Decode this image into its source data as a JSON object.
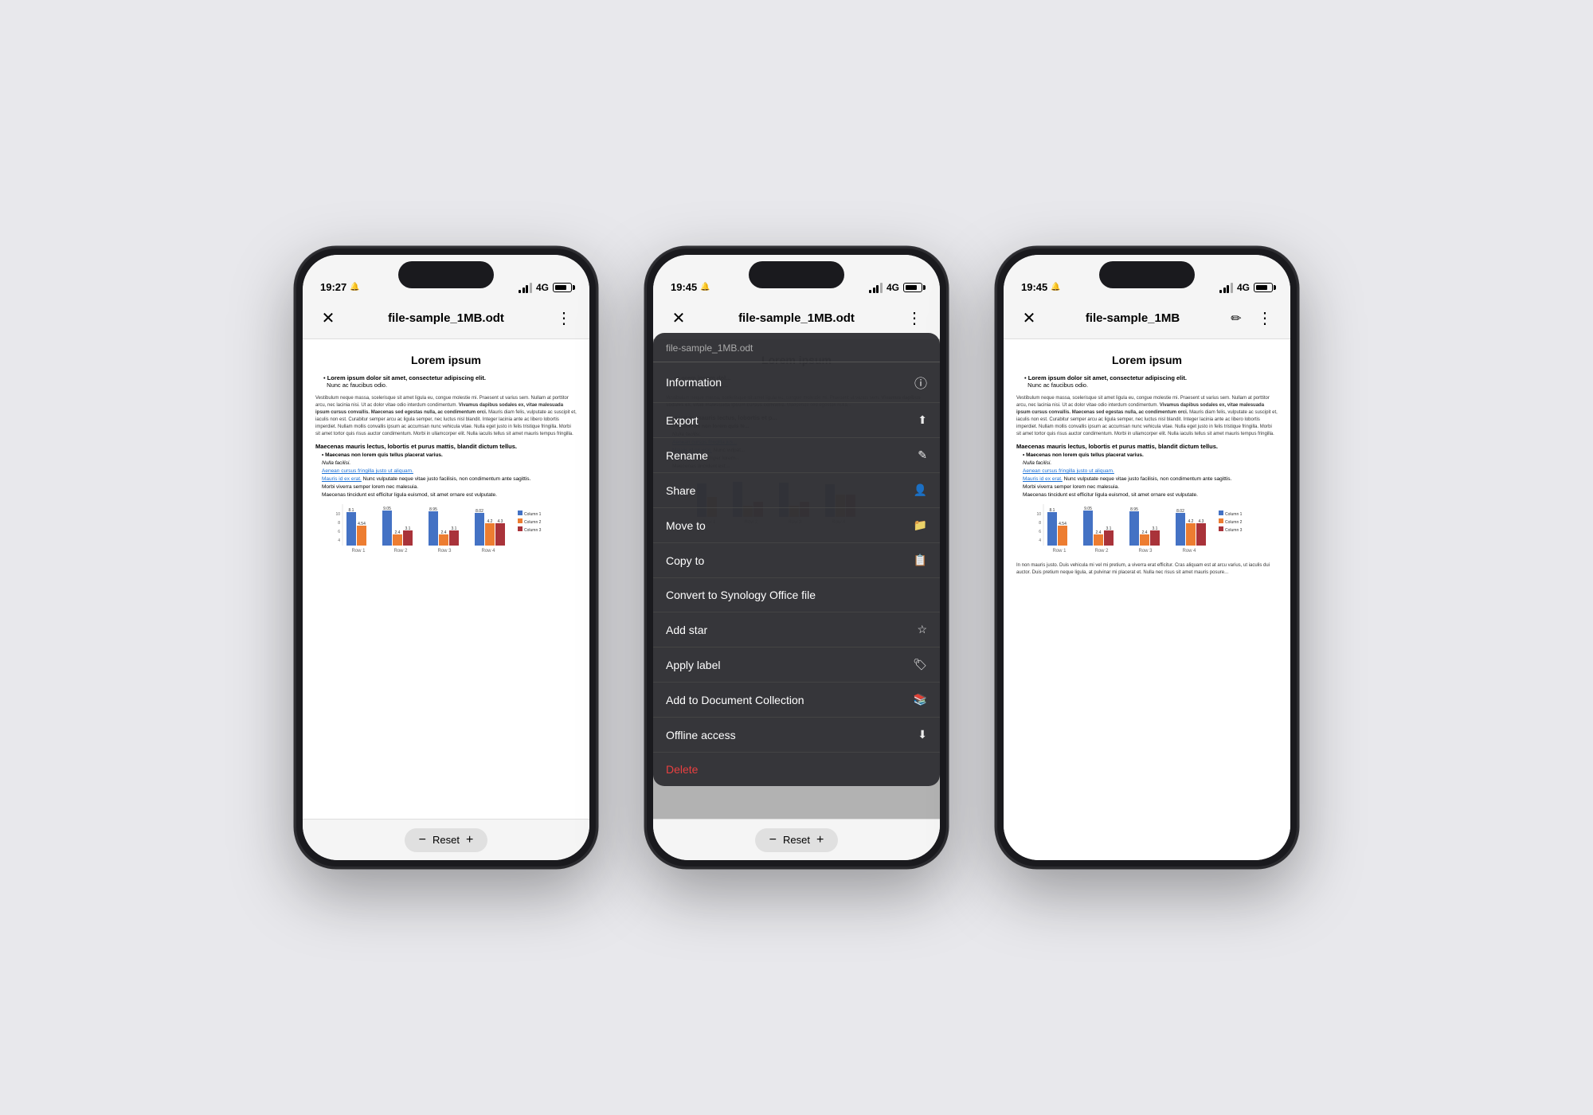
{
  "phones": [
    {
      "id": "phone1",
      "status_time": "19:27",
      "title": "file-sample_1MB.odt",
      "has_edit_icon": false,
      "show_menu": false,
      "doc": {
        "title": "Lorem ipsum",
        "bullet_bold": "Lorem ipsum dolor sit amet, consectetur adipiscing elit.",
        "bullet_normal": "Nunc ac faucibus odio.",
        "paragraphs": [
          "Vestibulum neque massa, scelerisque sit amet ligula eu, congue molestie mi. Praesent ut varius sem. Nullam at porttitor arcu, nec lacinia nisi. Ut ac dolor vitae odio interdum condimentum. Vivamus dapibus sodales ex, vitae malesuada ipsum cursus convallis. Maecenas sed egestas nulla, ac condimentum orci. Mauris diam felis, vulputate ac suscipit et, iaculis non est. Curabitur semper arcu ac ligula semper, nec luctus nisl blandit. Integer lacinia ante ac libero lobortis imperdiet. Nullam mollis convallis ipsum ac accumsan nunc vehicula vitae. Nulla eget justo in felis tristique fringilla. Morbi sit amet tortor quis risus auctor condimentum. Morbi in ullamcorper elit. Nulla iaculis tellus sit amet mauris tempus fringilla."
        ],
        "subheading": "Maecenas mauris lectus, lobortis et purus mattis, blandit dictum tellus.",
        "list_items": [
          {
            "text": "Maecenas non lorem quis tellus placerat varius.",
            "bold": true
          },
          {
            "text": "Nulla facilisi.",
            "italic": true
          },
          {
            "text": "Aenean cursus fringilla justo ut aliquam.",
            "underline": true
          },
          {
            "text": "Mauris id ex erat. Nunc vulputate neque vitae justo facilisis, non condimentum ante sagittis.",
            "partial_underline": true
          },
          {
            "text": "Morbi viverra semper lorem nec malesuia."
          },
          {
            "text": "Maecenas tincidunt est efficitur ligula euismod, sit amet ornare est vulputate."
          }
        ]
      },
      "bottom_bar": {
        "minus_label": "−",
        "reset_label": "Reset",
        "plus_label": "+"
      }
    },
    {
      "id": "phone2",
      "status_time": "19:45",
      "title": "file-sample_1MB.odt",
      "has_edit_icon": false,
      "show_menu": true,
      "menu": {
        "filename": "file-sample_1MB.odt",
        "items": [
          {
            "label": "Information",
            "icon": "ℹ"
          },
          {
            "label": "Export",
            "icon": "⬆"
          },
          {
            "label": "Rename",
            "icon": "✎"
          },
          {
            "label": "Share",
            "icon": "👤"
          },
          {
            "label": "Move to",
            "icon": ""
          },
          {
            "label": "Copy to",
            "icon": ""
          },
          {
            "label": "Convert to Synology Office file",
            "icon": ""
          },
          {
            "label": "Add star",
            "icon": ""
          },
          {
            "label": "Apply label",
            "icon": ""
          },
          {
            "label": "Add to Document Collection",
            "icon": ""
          },
          {
            "label": "Offline access",
            "icon": ""
          },
          {
            "label": "Delete",
            "icon": "",
            "red": true
          }
        ]
      },
      "doc": {
        "title": "Lorem ipsum",
        "bullet_bold": "Lorem ipsum dolor sit amet, consectetur adipiscing elit.",
        "bullet_normal": "Nunc ac faucibus odio.",
        "paragraphs": [
          "Vestibulum neque massa, scelerisque sit amet ligula eu, congue molestie mi..."
        ],
        "subheading": "Maecenas mauris lectus, lobortis et purus mattis, blandit dictum tellus.",
        "list_items": [
          {
            "text": "Maecenas non lorem quis tellus placerat varius.",
            "bold": true
          },
          {
            "text": "Nulla facilisi.",
            "italic": true
          }
        ]
      },
      "bottom_bar": {
        "minus_label": "−",
        "reset_label": "Reset",
        "plus_label": "+"
      }
    },
    {
      "id": "phone3",
      "status_time": "19:45",
      "title": "file-sample_1MB",
      "has_edit_icon": true,
      "show_menu": false,
      "doc": {
        "title": "Lorem ipsum",
        "bullet_bold": "Lorem ipsum dolor sit amet, consectetur adipiscing elit.",
        "bullet_normal": "Nunc ac faucibus odio.",
        "paragraphs": [
          "Vestibulum neque massa, scelerisque sit amet ligula eu, congue molestie mi. Praesent ut varius sem. Nullam at porttitor arcu, nec lacinia nisi. Ut ac dolor vitae odio interdum condimentum. Vivamus dapibus sodales ex, vitae malesuada ipsum cursus convallis. Maecenas sed egestas nulla, ac condimentum orci. Mauris diam felis, vulputate ac suscipit et, iaculis non est. Curabitur semper arcu ac ligula semper, nec luctus nisl blandit. Integer lacinia ante ac libero lobortis imperdiet. Nullam mollis convallis ipsum ac accumsan nunc vehicula vitae. Nulla eget justo in felis tristique fringilla. Morbi sit amet tortor quis risus auctor condimentum. Morbi in ullamcorper elit. Nulla iaculis tellus sit amet mauris tempus fringilla."
        ],
        "subheading": "Maecenas mauris lectus, lobortis et purus mattis, blandit dictum tellus.",
        "list_items": [
          {
            "text": "Maecenas non lorem quis tellus placerat varius.",
            "bold": true
          },
          {
            "text": "Nulla facilisi.",
            "italic": true
          },
          {
            "text": "Aenean cursus fringilla justo ut aliquam.",
            "underline": true
          },
          {
            "text": "Mauris id ex erat. Nunc vulputate neque vitae justo facilisis, non condimentum ante sagittis.",
            "partial_underline": true
          },
          {
            "text": "Morbi viverra semper lorem nec malesuia."
          },
          {
            "text": "Maecenas tincidunt est efficitur ligula euismod, sit amet ornare est vulputate."
          }
        ],
        "extra_para": "In non mauris justo. Duis vehicula mi vel mi pretium, a viverra erat efficitur. Cras aliquam est at arcu varius, ut iaculis dui auctor. Duis pretium neque ligula, at pulvinar mi placerat et. Nulla nec risus sit amet mauris posure..."
      },
      "bottom_bar": null
    }
  ],
  "colors": {
    "phone_bg": "#1a1a1e",
    "status_bg": "#f5f5f5",
    "doc_bg": "#ffffff",
    "menu_bg": "rgba(50,50,54,0.97)",
    "menu_border": "#555",
    "delete_red": "#e84040",
    "accent_blue": "#1a6fd4",
    "chart_col1": "#4472c4",
    "chart_col2": "#ed7d31",
    "chart_col3": "#a9333a"
  },
  "chart": {
    "rows": [
      "Row 1",
      "Row 2",
      "Row 3",
      "Row 4"
    ],
    "col1_label": "Column 1",
    "col2_label": "Column 2",
    "col3_label": "Column 3",
    "data": [
      [
        8.1,
        4.54,
        0
      ],
      [
        9.05,
        2.4,
        3.1
      ],
      [
        8.95,
        2.4,
        3.1
      ],
      [
        8.02,
        4.2,
        4.3
      ]
    ]
  }
}
